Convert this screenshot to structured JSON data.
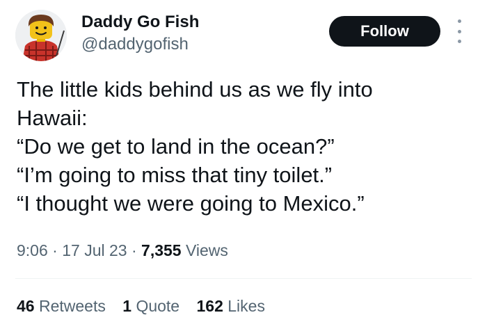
{
  "author": {
    "display_name": "Daddy Go Fish",
    "handle": "@daddygofish",
    "avatar_icon": "lego-minifigure-avatar"
  },
  "follow_label": "Follow",
  "more_icon": "more-options-icon",
  "tweet": {
    "lines": [
      "The little kids behind us as we fly into",
      "Hawaii:",
      "“Do we get to land in the ocean?”",
      "“I’m going to miss that tiny toilet.”",
      "“I thought we were going to Mexico.”"
    ]
  },
  "meta": {
    "time": "9:06",
    "sep1": "·",
    "date": "17 Jul 23",
    "sep2": "·",
    "views_count": "7,355",
    "views_label": "Views"
  },
  "stats": {
    "retweets_count": "46",
    "retweets_label": "Retweets",
    "quotes_count": "1",
    "quotes_label": "Quote",
    "likes_count": "162",
    "likes_label": "Likes"
  },
  "colors": {
    "text": "#0f1419",
    "secondary": "#536471",
    "button_bg": "#0f1419",
    "button_text": "#ffffff",
    "divider": "#eff3f4"
  }
}
